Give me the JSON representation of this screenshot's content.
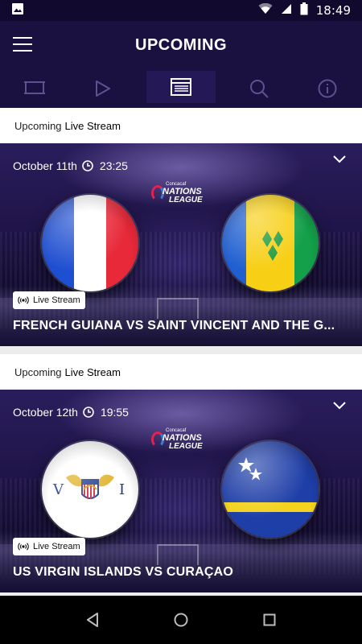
{
  "status_bar": {
    "time": "18:49"
  },
  "header": {
    "title": "UPCOMING"
  },
  "tabs": [
    {
      "name": "tv",
      "active": false
    },
    {
      "name": "play",
      "active": false
    },
    {
      "name": "list",
      "active": true
    },
    {
      "name": "search",
      "active": false
    },
    {
      "name": "info",
      "active": false
    }
  ],
  "events": [
    {
      "section_prefix": "Upcoming",
      "section_type": "Live Stream",
      "date": "October 11th",
      "time": "23:25",
      "league": {
        "line1": "Concacaf",
        "line2": "NATIONS",
        "line3": "LEAGUE"
      },
      "badge": "Live Stream",
      "match": "FRENCH GUIANA VS SAINT VINCENT AND THE G..."
    },
    {
      "section_prefix": "Upcoming",
      "section_type": "Live Stream",
      "date": "October 12th",
      "time": "19:55",
      "league": {
        "line1": "Concacaf",
        "line2": "NATIONS",
        "line3": "LEAGUE"
      },
      "badge": "Live Stream",
      "match": "US VIRGIN ISLANDS VS CURAÇAO"
    }
  ],
  "colors": {
    "header_bg": "#1b1140",
    "status_bg": "#120a2e",
    "accent_purple": "#8a7bd0"
  }
}
